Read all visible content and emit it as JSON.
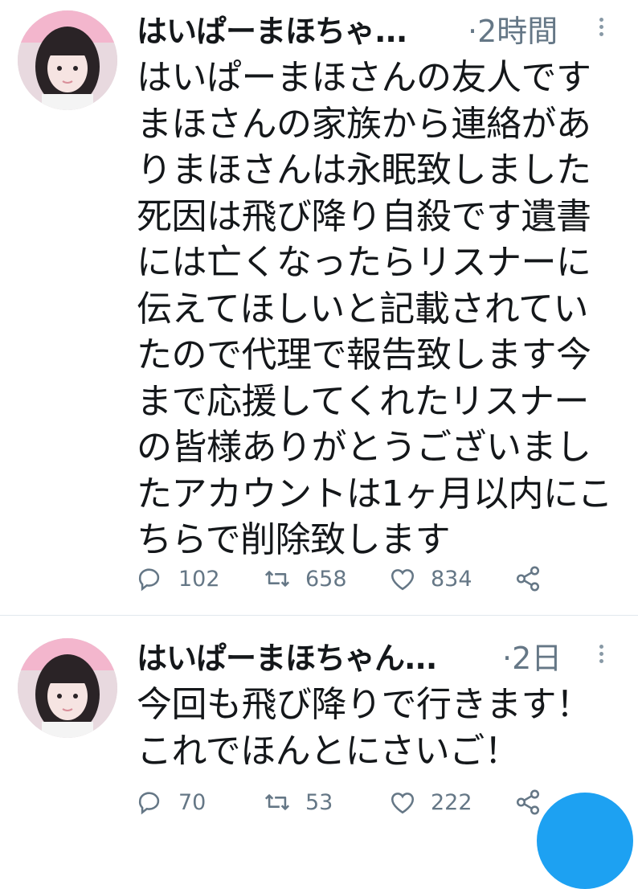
{
  "tweets": [
    {
      "display_name": "はいぱーまほちゃ...",
      "time": "·2時間",
      "text": "はいぱーまほさんの友人です\nまほさんの家族から連絡があ\nりまほさんは永眠致しました\n死因は飛び降り自殺です遺書\nには亡くなったらリスナーに\n伝えてほしいと記載されてい\nたので代理で報告致します今\nまで応援してくれたリスナー\nの皆様ありがとうございまし\nたアカウントは1ヶ月以内にこ\nちらで削除致します",
      "replies": "102",
      "retweets": "658",
      "likes": "834"
    },
    {
      "display_name": "はいぱーまほちゃん...",
      "time": "·2日",
      "text": "今回も飛び降りで行きます！\nこれでほんとにさいご！",
      "replies": "70",
      "retweets": "53",
      "likes": "222"
    }
  ],
  "icons": {
    "reply": "reply-icon",
    "retweet": "retweet-icon",
    "like": "heart-icon",
    "share": "share-icon",
    "more": "more-vertical-icon"
  },
  "colors": {
    "text": "#14171a",
    "muted": "#657786",
    "accent": "#1da1f2",
    "divider": "#e1e8ed"
  }
}
